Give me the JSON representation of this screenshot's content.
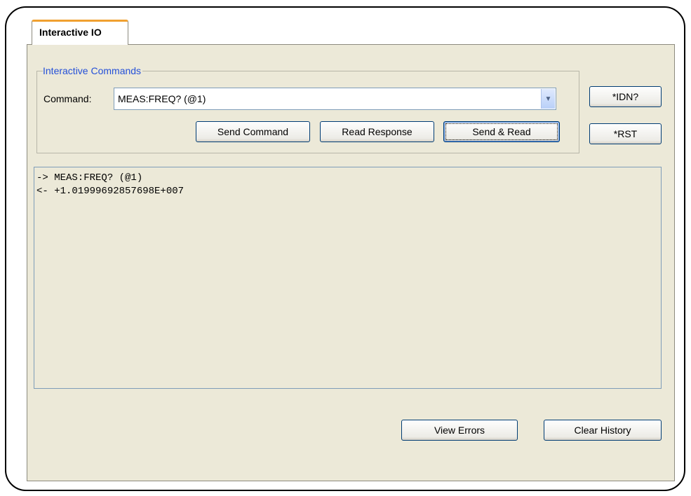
{
  "tab": {
    "label": "Interactive IO"
  },
  "commands_group": {
    "legend": "Interactive Commands",
    "command_label": "Command:",
    "command_value": "MEAS:FREQ? (@1)"
  },
  "buttons": {
    "send_command": "Send  Command",
    "read_response": "Read Response",
    "send_read": "Send & Read",
    "idn": "*IDN?",
    "rst": "*RST",
    "view_errors": "View Errors",
    "clear_history": "Clear History"
  },
  "history": [
    "-> MEAS:FREQ? (@1)",
    "<- +1.01999692857698E+007"
  ],
  "icons": {
    "dropdown": "chevron-down-icon"
  }
}
